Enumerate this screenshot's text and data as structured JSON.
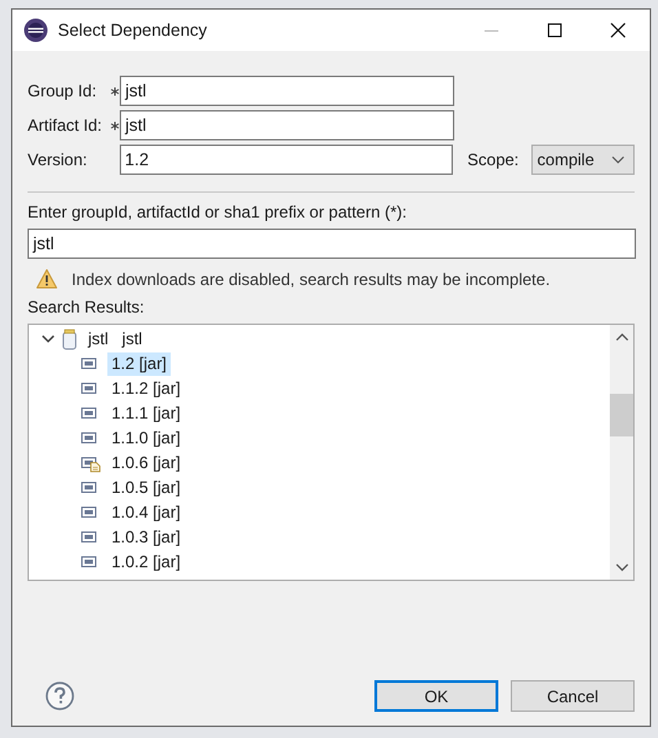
{
  "window": {
    "title": "Select Dependency"
  },
  "fields": [
    {
      "label": "Group Id:",
      "required": true,
      "value": "jstl"
    },
    {
      "label": "Artifact Id:",
      "required": true,
      "value": "jstl"
    },
    {
      "label": "Version:",
      "required": false,
      "value": "1.2"
    }
  ],
  "scope": {
    "label": "Scope:",
    "value": "compile"
  },
  "search": {
    "label": "Enter groupId, artifactId or sha1 prefix or pattern (*):",
    "value": "jstl"
  },
  "warning": "Index downloads are disabled, search results may be incomplete.",
  "results": {
    "label": "Search Results:",
    "tree": [
      {
        "group": "jstl",
        "artifact": "jstl",
        "expanded": true,
        "children": [
          {
            "label": "1.2 [jar]",
            "kind": "jar",
            "selected": true
          },
          {
            "label": "1.1.2 [jar]",
            "kind": "jar",
            "selected": false
          },
          {
            "label": "1.1.1 [jar]",
            "kind": "jar",
            "selected": false
          },
          {
            "label": "1.1.0 [jar]",
            "kind": "jar",
            "selected": false
          },
          {
            "label": "1.0.6 [jar]",
            "kind": "jar-with-source",
            "selected": false
          },
          {
            "label": "1.0.5 [jar]",
            "kind": "jar",
            "selected": false
          },
          {
            "label": "1.0.4 [jar]",
            "kind": "jar",
            "selected": false
          },
          {
            "label": "1.0.3 [jar]",
            "kind": "jar",
            "selected": false
          },
          {
            "label": "1.0.2 [jar]",
            "kind": "jar",
            "selected": false
          }
        ]
      }
    ]
  },
  "buttons": [
    {
      "label": "OK",
      "default": true
    },
    {
      "label": "Cancel",
      "default": false
    }
  ]
}
